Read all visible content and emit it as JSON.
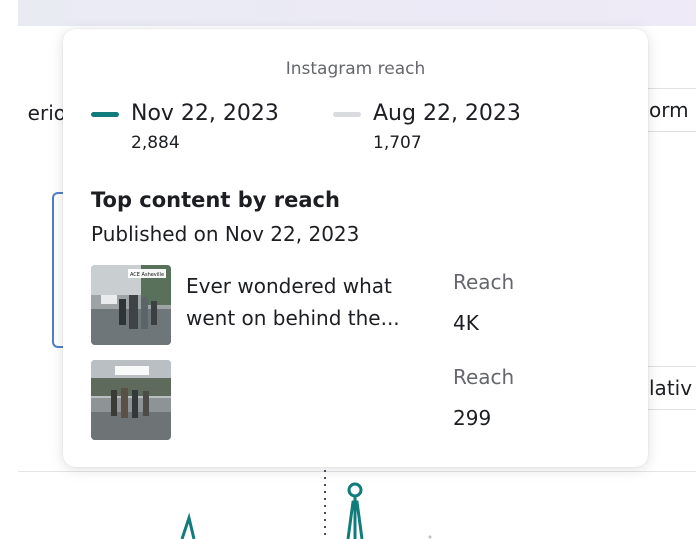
{
  "background": {
    "left_label_fragment": "erio",
    "right_label_top_fragment": "orm",
    "right_label_bottom_fragment": "lativ"
  },
  "tooltip": {
    "title": "Instagram reach",
    "legend": [
      {
        "date": "Nov 22, 2023",
        "value": "2,884",
        "color": "#127b7b"
      },
      {
        "date": "Aug 22, 2023",
        "value": "1,707",
        "color": "#d9dbdf"
      }
    ],
    "top_content": {
      "heading": "Top content by reach",
      "subheading": "Published on Nov 22, 2023",
      "items": [
        {
          "caption": "Ever wondered what went on behind the...",
          "metric_label": "Reach",
          "metric_value": "4K",
          "thumb_text": "ACE Asheville"
        },
        {
          "caption": "",
          "metric_label": "Reach",
          "metric_value": "299",
          "thumb_text": ""
        }
      ]
    }
  },
  "colors": {
    "accent": "#127b7b",
    "secondary_text": "#65676b",
    "primary_text": "#1c1e21"
  }
}
